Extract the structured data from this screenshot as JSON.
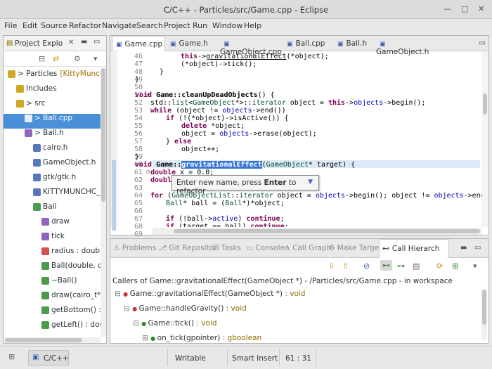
{
  "window": {
    "title": "C/C++ - Particles/src/Game.cpp - Eclipse"
  },
  "menu": [
    "File",
    "Edit",
    "Source",
    "Refactor",
    "Navigate",
    "Search",
    "Project",
    "Run",
    "Window",
    "Help"
  ],
  "project_explorer": {
    "title": "Project Explo",
    "tree": [
      {
        "label": "> Particles",
        "extra": "[KittyMunchC",
        "indent": 0,
        "icon": "project"
      },
      {
        "label": "Includes",
        "indent": 1,
        "icon": "includes"
      },
      {
        "label": "> src",
        "indent": 1,
        "icon": "folder"
      },
      {
        "label": "> Ball.cpp",
        "indent": 2,
        "icon": "cpp-file",
        "selected": true
      },
      {
        "label": "> Ball.h",
        "indent": 2,
        "icon": "h-file"
      },
      {
        "label": "cairo.h",
        "indent": 3,
        "icon": "include"
      },
      {
        "label": "GameObject.h",
        "indent": 3,
        "icon": "include"
      },
      {
        "label": "gtk/gtk.h",
        "indent": 3,
        "icon": "include"
      },
      {
        "label": "KITTYMUNCHC_S",
        "indent": 3,
        "icon": "macro"
      },
      {
        "label": "Ball",
        "indent": 3,
        "icon": "class"
      },
      {
        "label": "draw",
        "indent": 4,
        "icon": "field"
      },
      {
        "label": "tick",
        "indent": 4,
        "icon": "field"
      },
      {
        "label": "radius : double",
        "indent": 4,
        "icon": "private"
      },
      {
        "label": "Ball(double, dou",
        "indent": 4,
        "icon": "method"
      },
      {
        "label": "~Ball()",
        "indent": 4,
        "icon": "method"
      },
      {
        "label": "draw(cairo_t*)",
        "indent": 4,
        "icon": "method"
      },
      {
        "label": "getBottom() : d",
        "indent": 4,
        "icon": "method"
      },
      {
        "label": "getLeft() : dou",
        "indent": 4,
        "icon": "method"
      }
    ]
  },
  "editor": {
    "tabs": [
      {
        "label": "Game.cpp",
        "active": true
      },
      {
        "label": "Game.h"
      },
      {
        "label": "GameObject.cpp"
      },
      {
        "label": "Ball.cpp"
      },
      {
        "label": "Ball.h"
      },
      {
        "label": "GameObject.h"
      }
    ],
    "line_numbers": [
      "46",
      "47",
      "48",
      "49",
      "50",
      "51",
      "52",
      "53",
      "54",
      "55",
      "56",
      "57",
      "58",
      "59",
      "60",
      "61",
      "62",
      "63",
      "64",
      "65",
      "66",
      "67",
      "68",
      "69"
    ],
    "tooltip": {
      "before": "Enter new name, press ",
      "key": "Enter",
      "after": " to refactor"
    }
  },
  "bottom_panel": {
    "tabs": [
      "Problems",
      "Git Repositori",
      "Tasks",
      "Console",
      "Call Graph",
      "Make Target",
      "Call Hierarch"
    ],
    "caption": "Callers of Game::gravitationalEffect(GameObject *) - /Particles/src/Game.cpp - in workspace",
    "rows": [
      {
        "name": "Game::gravitationalEffect(GameObject *)",
        "ret": " : void",
        "indent": 0
      },
      {
        "name": "Game::handleGravity()",
        "ret": " : void",
        "indent": 1
      },
      {
        "name": "Game::tick()",
        "ret": " : void",
        "indent": 2
      },
      {
        "name": "on_tick(gpointer)",
        "ret": " : gboolean",
        "indent": 3
      }
    ]
  },
  "status": {
    "perspective": "C/C++",
    "writable": "Writable",
    "insert_mode": "Smart Insert",
    "position": "61 : 31"
  }
}
